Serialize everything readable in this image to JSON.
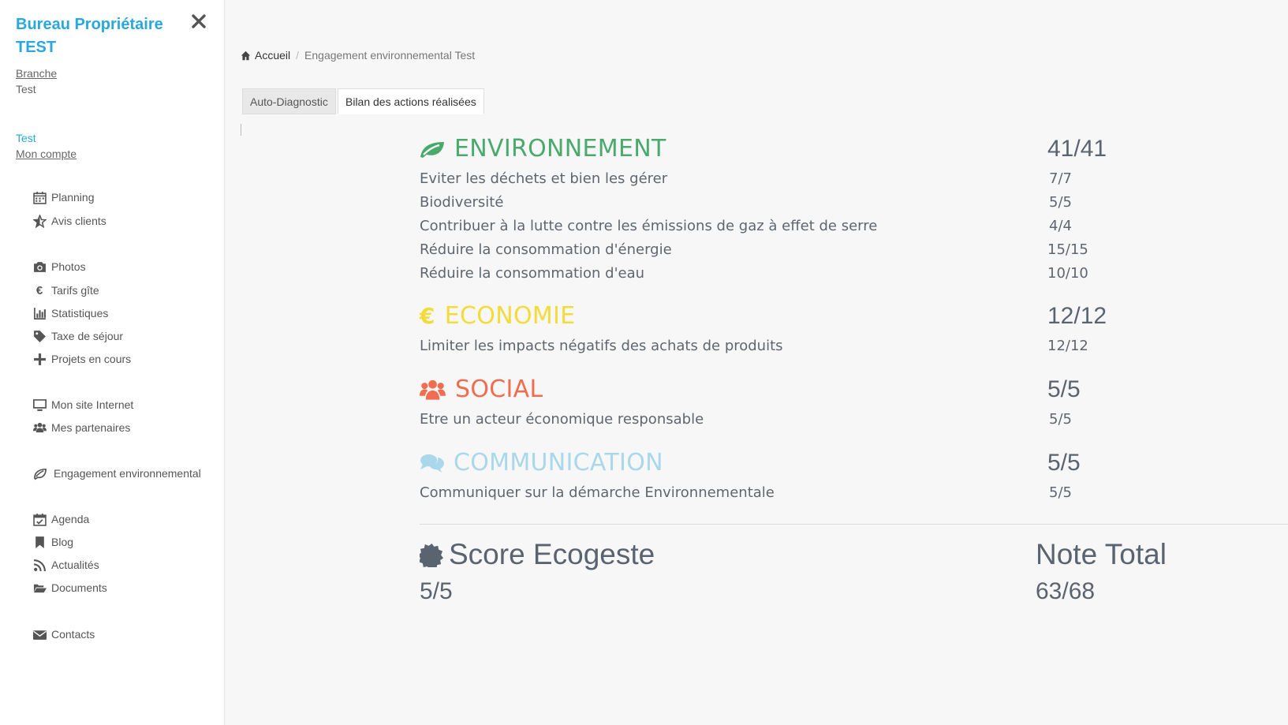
{
  "sidebar": {
    "brand": "Bureau Propriétaire TEST",
    "branch_label": "Branche",
    "branch_value": "Test",
    "user_name": "Test",
    "account_link": "Mon compte",
    "items": [
      {
        "label": "Planning",
        "icon": "calendar-icon"
      },
      {
        "label": "Avis clients",
        "icon": "star-half-icon"
      },
      {
        "label": "Photos",
        "icon": "camera-icon"
      },
      {
        "label": "Tarifs gîte",
        "icon": "euro-icon"
      },
      {
        "label": "Statistiques",
        "icon": "bar-chart-icon"
      },
      {
        "label": "Taxe de séjour",
        "icon": "tag-icon"
      },
      {
        "label": "Projets en cours",
        "icon": "plus-icon"
      },
      {
        "label": "Mon site Internet",
        "icon": "desktop-icon"
      },
      {
        "label": "Mes partenaires",
        "icon": "users-icon"
      },
      {
        "label": "Engagement environnemental",
        "icon": "leaf-icon"
      },
      {
        "label": "Agenda",
        "icon": "calendar-check-icon"
      },
      {
        "label": "Blog",
        "icon": "bookmark-icon"
      },
      {
        "label": "Actualités",
        "icon": "rss-icon"
      },
      {
        "label": "Documents",
        "icon": "folder-open-icon"
      },
      {
        "label": "Contacts",
        "icon": "envelope-icon"
      }
    ]
  },
  "breadcrumb": {
    "home": "Accueil",
    "current": "Engagement environnemental Test"
  },
  "tabs": {
    "auto": "Auto-Diagnostic",
    "bilan": "Bilan des actions réalisées"
  },
  "sections": {
    "environnement": {
      "title": "ENVIRONNEMENT",
      "score": "41/41",
      "color": "#4aaa6b",
      "icon": "leaf-icon",
      "rows": [
        {
          "label": "Eviter les déchets et bien les gérer",
          "value": "7/7"
        },
        {
          "label": "Biodiversité",
          "value": "5/5"
        },
        {
          "label": "Contribuer à la lutte contre les émissions de gaz à effet de serre",
          "value": "4/4"
        },
        {
          "label": "Réduire la consommation d'énergie",
          "value": "15/15"
        },
        {
          "label": "Réduire la consommation d'eau",
          "value": "10/10"
        }
      ]
    },
    "economie": {
      "title": "ECONOMIE",
      "score": "12/12",
      "color": "#f3dc3a",
      "icon": "euro-icon",
      "rows": [
        {
          "label": "Limiter les impacts négatifs des achats de produits",
          "value": "12/12"
        }
      ]
    },
    "social": {
      "title": "SOCIAL",
      "score": "5/5",
      "color": "#f26d4f",
      "icon": "users-icon",
      "rows": [
        {
          "label": "Etre un acteur économique responsable",
          "value": "5/5"
        }
      ]
    },
    "communication": {
      "title": "COMMUNICATION",
      "score": "5/5",
      "color": "#a9d8ea",
      "icon": "comments-icon",
      "rows": [
        {
          "label": "Communiquer sur la démarche Environnementale",
          "value": "5/5"
        }
      ]
    }
  },
  "summary": {
    "score_title": "Score Ecogeste",
    "score_value": "5/5",
    "total_title": "Note Total",
    "total_value": "63/68"
  }
}
